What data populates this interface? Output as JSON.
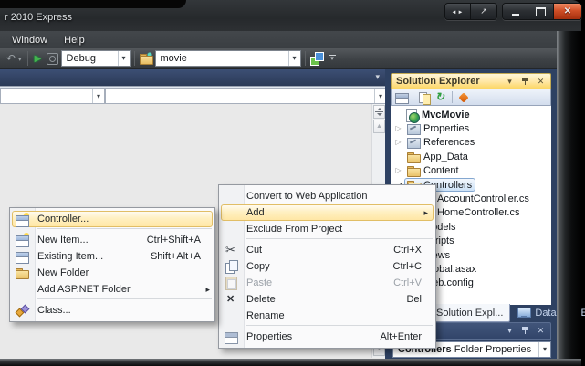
{
  "colors": {
    "menu_highlight": "#FFE7A5",
    "menu_highlight_border": "#E1BE66",
    "active_panel_title_gold": "#FCD665",
    "panel_chrome_navy": "#2E4162",
    "selection_blue_border": "#84A7D0",
    "close_button_red": "#CF4E26",
    "run_green": "#44B44E"
  },
  "window": {
    "title": "r 2010 Express",
    "caption_buttons": [
      {
        "name": "dock-arrows-button",
        "icon": "dock-arrows-icon"
      },
      {
        "name": "popout-button",
        "icon": "popout-icon"
      },
      {
        "name": "minimize-button",
        "icon": "minimize-icon"
      },
      {
        "name": "maximize-button",
        "icon": "maximize-icon"
      },
      {
        "name": "close-button",
        "icon": "close-icon"
      }
    ]
  },
  "menubar": {
    "items": [
      {
        "label": "Window",
        "name": "menubar-item-window"
      },
      {
        "label": "Help",
        "name": "menubar-item-help"
      }
    ]
  },
  "toolbar": {
    "debug_value": "Debug",
    "search_value": "movie",
    "icons": {
      "undo": "undo-icon",
      "undo_caret": "undo-dropdown-icon",
      "run": "run-icon",
      "navigate": "navigate-icon",
      "find": "find-in-folder-icon",
      "badge": "extension-icon",
      "overflow": "toolbar-overflow-icon"
    }
  },
  "editor": {
    "nav_combo1_value": "",
    "nav_combo2_value": ""
  },
  "solution_explorer": {
    "title": "Solution Explorer",
    "toolbar": [
      {
        "ic": "ic-tprops",
        "icon": "properties-window-icon",
        "name": "se-toolbar-properties",
        "interactable": true
      },
      {
        "cls": "sesep",
        "name": "se-toolbar-separator",
        "interactable": false
      },
      {
        "ic": "ic-showall",
        "icon": "show-all-files-icon",
        "name": "se-toolbar-show-all-files",
        "interactable": true
      },
      {
        "ic": "ic-refresh",
        "icon": "refresh-icon",
        "name": "se-toolbar-refresh",
        "interactable": true
      },
      {
        "cls": "sesep",
        "name": "se-toolbar-separator",
        "interactable": false
      },
      {
        "ic": "ic-classdg",
        "icon": "class-diagram-icon",
        "name": "se-toolbar-class-diagram",
        "interactable": true
      }
    ],
    "tree": [
      {
        "label": "MvcMovie",
        "cls": "lv0 bold",
        "arrow": "",
        "ic": "ic-proj",
        "icon": "web-project-icon",
        "name": "tree-item-mvcmovie"
      },
      {
        "label": "Properties",
        "cls": "lv1",
        "arrow": "▷",
        "ic": "ic-propfold",
        "icon": "properties-node-icon",
        "name": "tree-item-properties"
      },
      {
        "label": "References",
        "cls": "lv1",
        "arrow": "▷",
        "ic": "ic-reffold",
        "icon": "references-icon",
        "name": "tree-item-references"
      },
      {
        "label": "App_Data",
        "cls": "lv1",
        "arrow": "",
        "ic": "ic-folder",
        "icon": "folder-icon",
        "name": "tree-item-app-data"
      },
      {
        "label": "Content",
        "cls": "lv1",
        "arrow": "▷",
        "ic": "ic-folder",
        "icon": "folder-icon",
        "name": "tree-item-content"
      },
      {
        "label": "Controllers",
        "cls": "lv1 selected exp",
        "arrow": "◢",
        "ic": "ic-folder-open",
        "icon": "open-folder-icon",
        "name": "tree-item-controllers"
      },
      {
        "label": "AccountController.cs",
        "cls": "lv2",
        "arrow": "",
        "ic": "ic-doc",
        "icon": "cs-file-icon",
        "name": "tree-item-accountcontroller"
      },
      {
        "label": "HomeController.cs",
        "cls": "lv2",
        "arrow": "",
        "ic": "ic-doc",
        "icon": "cs-file-icon",
        "name": "tree-item-homecontroller"
      },
      {
        "label": "Models",
        "cls": "lv1",
        "arrow": "▷",
        "ic": "ic-folder",
        "icon": "folder-icon",
        "name": "tree-item-models"
      },
      {
        "label": "Scripts",
        "cls": "lv1",
        "arrow": "▷",
        "ic": "ic-folder",
        "icon": "folder-icon",
        "name": "tree-item-scripts"
      },
      {
        "label": "Views",
        "cls": "lv1",
        "arrow": "▷",
        "ic": "ic-folder",
        "icon": "folder-icon",
        "name": "tree-item-views"
      },
      {
        "label": "Global.asax",
        "cls": "lv1",
        "arrow": "",
        "ic": "ic-doc",
        "icon": "file-icon",
        "name": "tree-item-global-asax"
      },
      {
        "label": "Web.config",
        "cls": "lv1",
        "arrow": "",
        "ic": "ic-doc",
        "icon": "file-icon",
        "name": "tree-item-web-config"
      }
    ]
  },
  "bottom_tabs": [
    {
      "label": "Solution Expl...",
      "cls": "active",
      "name": "tab-solution-explorer"
    },
    {
      "label": "Database Exp...",
      "ic": "ic-monitor",
      "icon": "database-explorer-icon",
      "name": "tab-database-explorer"
    }
  ],
  "properties_panel": {
    "selector_bold": "Controllers",
    "selector_rest": " Folder Properties"
  },
  "context_menu": {
    "items": [
      {
        "label": "Convert to Web Application",
        "name": "menu-item-convert-to-web-application"
      },
      {
        "label": "Add",
        "arrow": "▸",
        "cls": "hl",
        "name": "menu-item-add"
      },
      {
        "label": "Exclude From Project",
        "name": "menu-item-exclude-from-project"
      },
      {
        "cls": "sep",
        "name": "menu-separator",
        "interactable": false
      },
      {
        "label": "Cut",
        "shortcut": "Ctrl+X",
        "ic": "ic-cut",
        "icon": "cut-icon",
        "name": "menu-item-cut"
      },
      {
        "label": "Copy",
        "shortcut": "Ctrl+C",
        "ic": "ic-copy",
        "icon": "copy-icon",
        "name": "menu-item-copy"
      },
      {
        "label": "Paste",
        "shortcut": "Ctrl+V",
        "cls": "dis",
        "ic": "ic-paste",
        "icon": "paste-icon",
        "name": "menu-item-paste"
      },
      {
        "label": "Delete",
        "shortcut": "Del",
        "ic": "ic-del",
        "icon": "delete-icon",
        "name": "menu-item-delete"
      },
      {
        "label": "Rename",
        "name": "menu-item-rename"
      },
      {
        "cls": "sep",
        "name": "menu-separator",
        "interactable": false
      },
      {
        "label": "Properties",
        "shortcut": "Alt+Enter",
        "ic": "ic-props",
        "icon": "properties-icon",
        "name": "menu-item-properties"
      }
    ]
  },
  "add_submenu": {
    "items": [
      {
        "label": "Controller...",
        "cls": "hl",
        "ic": "ic-win spark",
        "icon": "controller-icon",
        "name": "menu-item-controller"
      },
      {
        "cls": "sep",
        "name": "menu-separator",
        "interactable": false
      },
      {
        "label": "New Item...",
        "shortcut": "Ctrl+Shift+A",
        "ic": "ic-win spark",
        "icon": "new-item-icon",
        "name": "menu-item-new-item"
      },
      {
        "label": "Existing Item...",
        "shortcut": "Shift+Alt+A",
        "ic": "ic-win",
        "icon": "existing-item-icon",
        "name": "menu-item-existing-item"
      },
      {
        "label": "New Folder",
        "ic": "ic-folder",
        "icon": "new-folder-icon",
        "name": "menu-item-new-folder"
      },
      {
        "label": "Add ASP.NET Folder",
        "arrow": "▸",
        "name": "menu-item-add-aspnet-folder"
      },
      {
        "cls": "sep",
        "name": "menu-separator",
        "interactable": false
      },
      {
        "label": "Class...",
        "ic": "ic-class",
        "icon": "class-icon",
        "name": "menu-item-class"
      }
    ]
  }
}
